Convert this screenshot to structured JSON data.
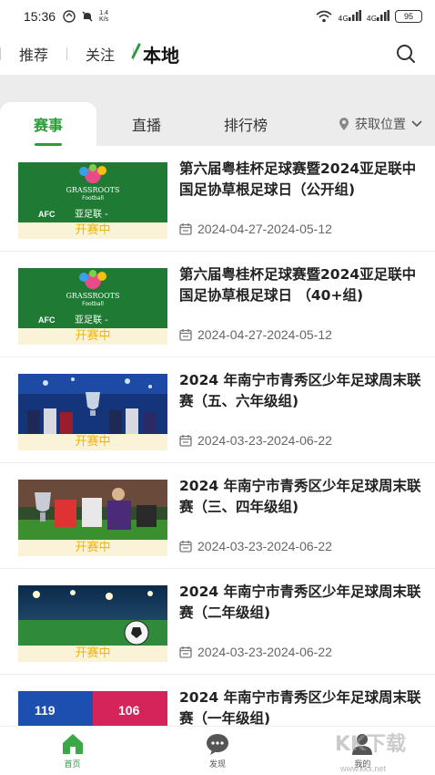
{
  "status": {
    "time": "15:36",
    "speed_top": "1.4",
    "speed_bottom": "K/s",
    "signal1": "4G",
    "signal2": "4G",
    "battery": "95"
  },
  "topnav": {
    "tabs": [
      "推荐",
      "关注",
      "本地"
    ],
    "active_index": 2
  },
  "subtabs": {
    "items": [
      "赛事",
      "直播",
      "排行榜"
    ],
    "active_index": 0,
    "location_label": "获取位置"
  },
  "events": [
    {
      "title": "第六届粤桂杯足球赛暨2024亚足联中国足协草根足球日（公开组)",
      "date": "2024-04-27-2024-05-12",
      "status": "开赛中",
      "thumb": "grassroots"
    },
    {
      "title": "第六届粤桂杯足球赛暨2024亚足联中国足协草根足球日 （40+组)",
      "date": "2024-04-27-2024-05-12",
      "status": "开赛中",
      "thumb": "grassroots"
    },
    {
      "title": "2024 年南宁市青秀区少年足球周末联赛（五、六年级组)",
      "date": "2024-03-23-2024-06-22",
      "status": "开赛中",
      "thumb": "trophy"
    },
    {
      "title": "2024 年南宁市青秀区少年足球周末联赛（三、四年级组)",
      "date": "2024-03-23-2024-06-22",
      "status": "开赛中",
      "thumb": "player"
    },
    {
      "title": "2024 年南宁市青秀区少年足球周末联赛（二年级组)",
      "date": "2024-03-23-2024-06-22",
      "status": "开赛中",
      "thumb": "ball"
    },
    {
      "title": "2024 年南宁市青秀区少年足球周末联赛（一年级组)",
      "date": "",
      "status": "",
      "thumb": "jersey"
    }
  ],
  "thumb_text": {
    "grassroots_line1": "GRASSROOTS",
    "grassroots_line2": "Football",
    "afc_label": "AFC",
    "afc_cn": "亚足联 -",
    "jersey_num1": "119",
    "jersey_num2": "106"
  },
  "bottomnav": {
    "items": [
      "首页",
      "发现",
      "我的"
    ],
    "active_index": 0
  },
  "watermark": {
    "text": "KK下载",
    "url": "www.kkx.net"
  },
  "colors": {
    "accent": "#2a9d3a",
    "badge_text": "#f0b400",
    "badge_bg": "#fbf3d8"
  }
}
